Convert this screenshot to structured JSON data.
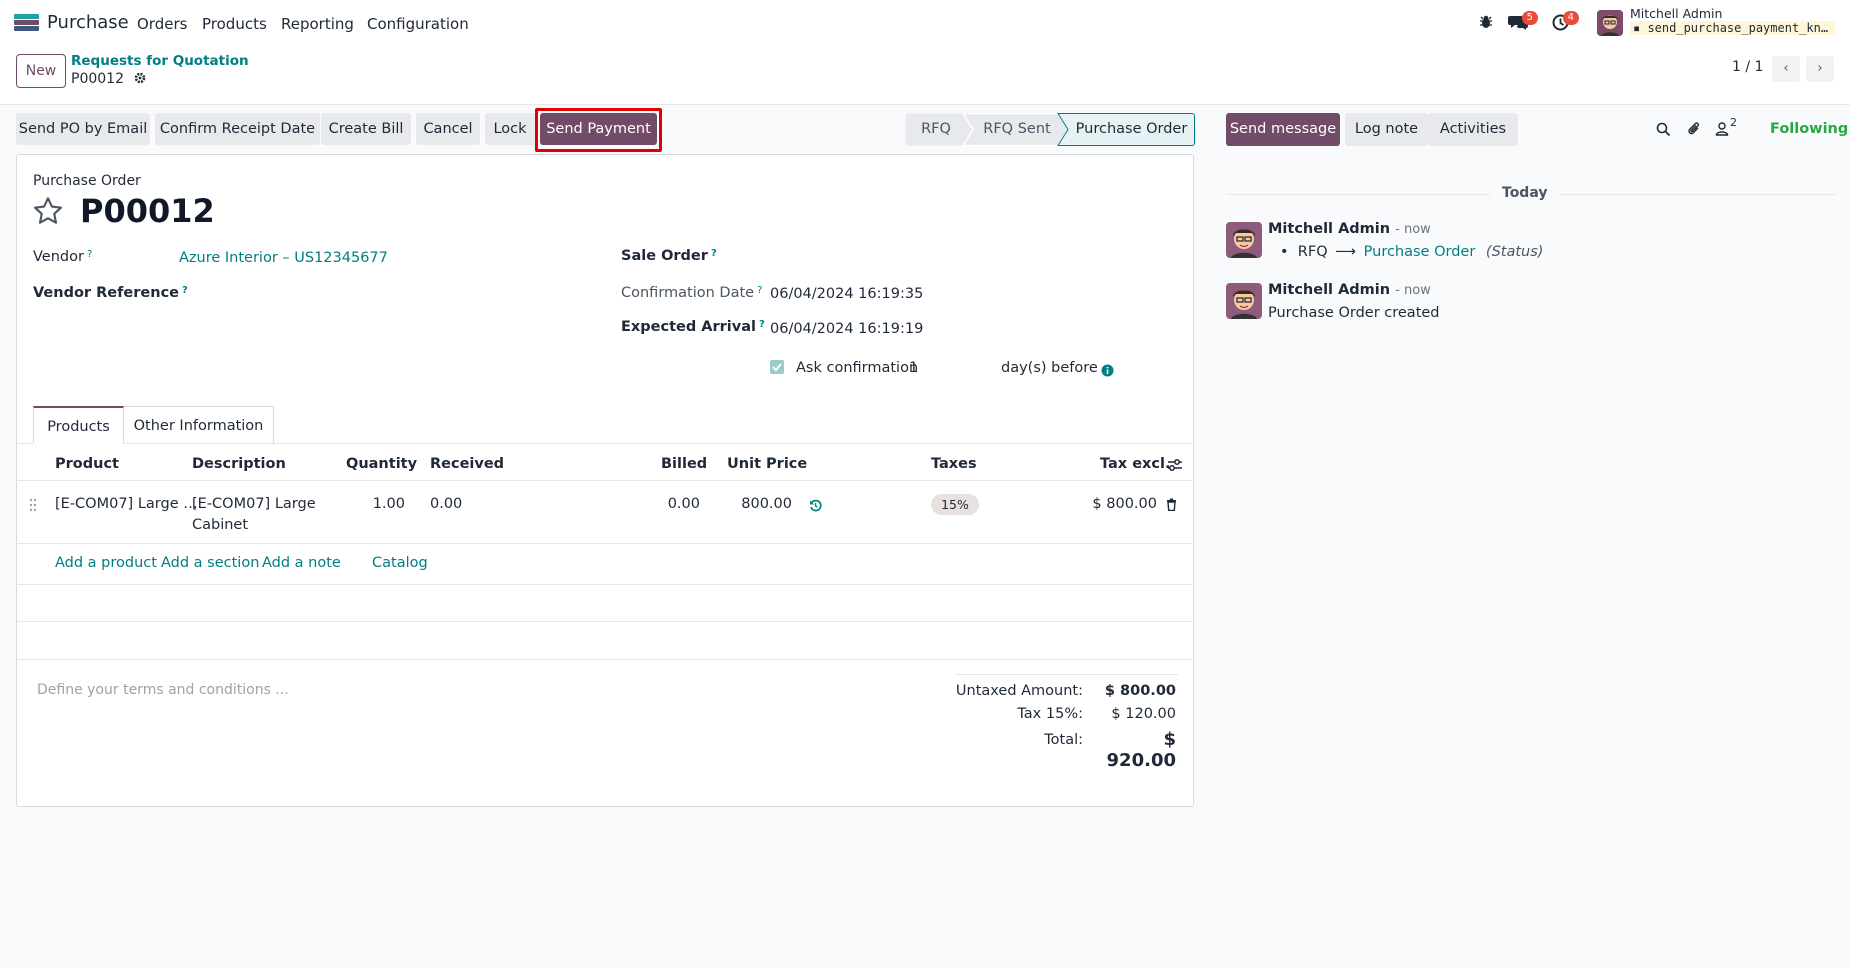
{
  "nav": {
    "app_name": "Purchase",
    "menu": [
      "Orders",
      "Products",
      "Reporting",
      "Configuration"
    ],
    "messages_count": "5",
    "activities_count": "4",
    "user_name": "Mitchell Admin",
    "db_name": "send_purchase_payment_kn…"
  },
  "control": {
    "new_label": "New",
    "breadcrumb": "Requests for Quotation",
    "current": "P00012",
    "pager": "1 / 1"
  },
  "actions": {
    "send_po": "Send PO by Email",
    "confirm_receipt": "Confirm Receipt Date",
    "create_bill": "Create Bill",
    "cancel": "Cancel",
    "lock": "Lock",
    "send_payment": "Send Payment"
  },
  "statusbar": [
    "RFQ",
    "RFQ Sent",
    "Purchase Order"
  ],
  "form": {
    "doc_type": "Purchase Order",
    "name": "P00012",
    "vendor_label": "Vendor",
    "vendor_value": "Azure Interior – US12345677",
    "vendor_ref_label": "Vendor Reference",
    "sale_order_label": "Sale Order",
    "confirm_date_label": "Confirmation Date",
    "confirm_date_value": "06/04/2024 16:19:35",
    "expected_arrival_label": "Expected Arrival",
    "expected_arrival_value": "06/04/2024 16:19:19",
    "ask_confirm_label": "Ask confirmation",
    "ask_confirm_days": "1",
    "days_before": "day(s) before"
  },
  "tabs": [
    "Products",
    "Other Information"
  ],
  "table": {
    "headers": [
      "Product",
      "Description",
      "Quantity",
      "Received",
      "Billed",
      "Unit Price",
      "Taxes",
      "Tax excl."
    ],
    "row": {
      "product": "[E-COM07] Large …",
      "description_1": "[E-COM07] Large",
      "description_2": "Cabinet",
      "quantity": "1.00",
      "received": "0.00",
      "billed": "0.00",
      "unit_price": "800.00",
      "tax": "15%",
      "subtotal": "$ 800.00"
    },
    "add_links": [
      "Add a product",
      "Add a section",
      "Add a note",
      "Catalog"
    ]
  },
  "terms_placeholder": "Define your terms and conditions ...",
  "totals": {
    "untaxed_label": "Untaxed Amount:",
    "untaxed_value": "$ 800.00",
    "tax_label": "Tax 15%:",
    "tax_value": "$ 120.00",
    "total_label": "Total:",
    "total_value": "$ 920.00"
  },
  "chatter": {
    "send_message": "Send message",
    "log_note": "Log note",
    "activities": "Activities",
    "followers_count": "2",
    "following": "Following",
    "today": "Today",
    "messages": [
      {
        "author": "Mitchell Admin",
        "time": "- now",
        "from": "RFQ",
        "to": "Purchase Order",
        "field": "(Status)"
      },
      {
        "author": "Mitchell Admin",
        "time": "- now",
        "body": "Purchase Order created"
      }
    ]
  },
  "colors": {
    "primary": "#714b67",
    "link": "#017e84",
    "highlight": "#e00000"
  }
}
